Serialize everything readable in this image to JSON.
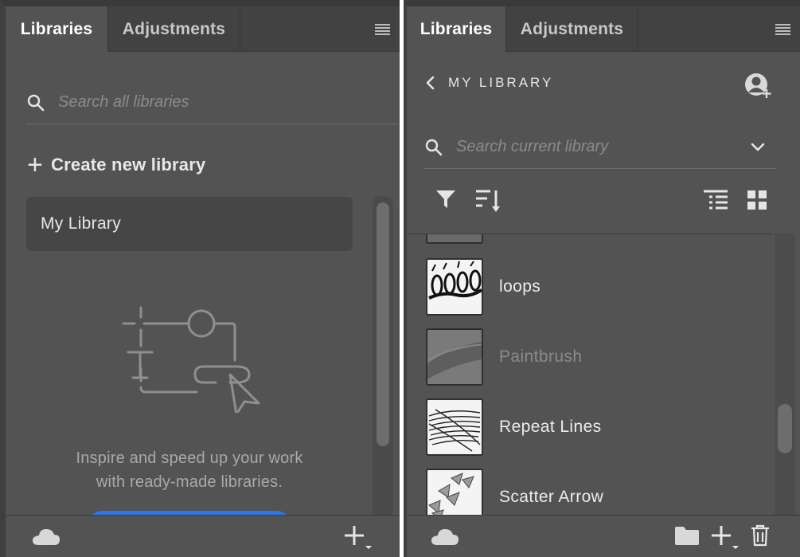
{
  "left_panel": {
    "tabs": [
      {
        "label": "Libraries",
        "active": true
      },
      {
        "label": "Adjustments",
        "active": false
      }
    ],
    "search": {
      "placeholder": "Search all libraries",
      "value": ""
    },
    "create_label": "Create new library",
    "libraries": [
      {
        "name": "My Library"
      }
    ],
    "empty_state": {
      "line1": "Inspire and speed up your work",
      "line2": "with ready-made libraries."
    }
  },
  "right_panel": {
    "tabs": [
      {
        "label": "Libraries",
        "active": true
      },
      {
        "label": "Adjustments",
        "active": false
      }
    ],
    "breadcrumb": "MY LIBRARY",
    "search": {
      "placeholder": "Search current library",
      "value": ""
    },
    "items": [
      {
        "name": "",
        "disabled": false
      },
      {
        "name": "loops",
        "disabled": false
      },
      {
        "name": "Paintbrush",
        "disabled": true
      },
      {
        "name": "Repeat Lines",
        "disabled": false
      },
      {
        "name": "Scatter Arrow",
        "disabled": false
      }
    ]
  },
  "colors": {
    "panel_bg": "#535353",
    "tab_bar_bg": "#424242",
    "accent_blue": "#2c78e6",
    "text_primary": "#e6e6e6",
    "text_muted": "#8b8b8b"
  },
  "icons": {
    "search": "search-icon",
    "menu": "hamburger-menu-icon",
    "cloud": "creative-cloud-icon",
    "add": "plus-icon",
    "back": "chevron-left-icon",
    "add_user": "add-user-icon",
    "expand": "chevron-down-icon",
    "filter": "filter-icon",
    "sort": "sort-icon",
    "list_view": "list-view-icon",
    "grid_view": "grid-view-icon",
    "folder": "folder-icon",
    "delete": "trash-icon"
  }
}
